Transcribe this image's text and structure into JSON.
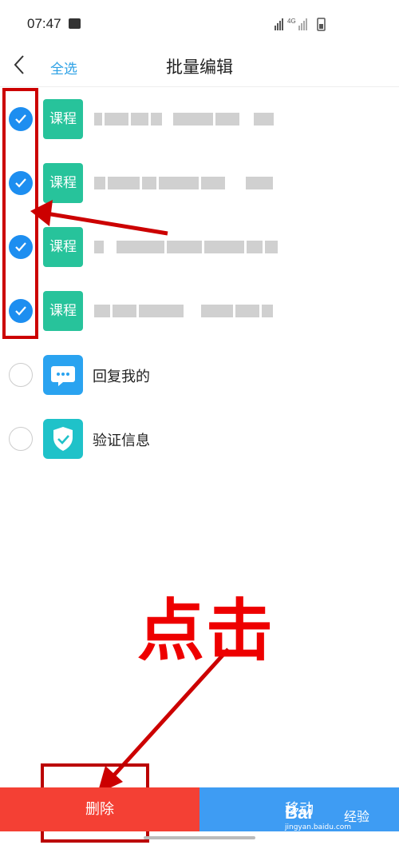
{
  "status": {
    "time": "07:47",
    "network": "4G"
  },
  "nav": {
    "back_glyph": "<",
    "select_all": "全选",
    "title": "批量编辑"
  },
  "rows": [
    {
      "tag": "课程",
      "checked": true
    },
    {
      "tag": "课程",
      "checked": true
    },
    {
      "tag": "课程",
      "checked": true
    },
    {
      "tag": "课程",
      "checked": true
    },
    {
      "label": "回复我的",
      "checked": false,
      "icon": "chat-bubble-icon"
    },
    {
      "label": "验证信息",
      "checked": false,
      "icon": "shield-check-icon"
    }
  ],
  "bottom": {
    "delete": "删除",
    "move": "移动"
  },
  "annotation": {
    "text": "点击"
  },
  "watermark": {
    "brand": "Bai",
    "suffix": "经验",
    "url": "jingyan.baidu.com"
  },
  "colors": {
    "accent": "#2da1e5",
    "check": "#1d8ef0",
    "tag": "#27c39b",
    "delete": "#f44034",
    "move": "#3e9cf3",
    "annotation": "#e00000"
  }
}
